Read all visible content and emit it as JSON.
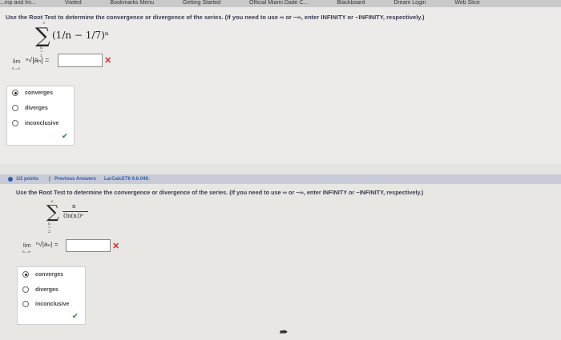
{
  "bookmarks": {
    "items": [
      "...mp and Im...",
      "Visited",
      "Bookmarks Menu",
      "Getting Started",
      "Official Miami Dade C...",
      "Blackboard",
      "Dream Login",
      "Web Slice"
    ]
  },
  "q1": {
    "instruction": "Use the Root Test to determine the convergence or divergence of the series. (If you need to use ∞ or −∞, enter INFINITY or −INFINITY, respectively.)",
    "series_top": "∞",
    "series_bottom": "n = 1",
    "series_term": "(1/n − 1/7)ⁿ",
    "lim_label": "lim",
    "lim_sub": "n→∞",
    "root_expr": "ⁿ√|aₙ| =",
    "answer_value": "",
    "result_icon": "✕",
    "options": [
      "converges",
      "diverges",
      "inconclusive"
    ],
    "selected": "converges",
    "check_icon": "✔"
  },
  "q2": {
    "points": "1/2 points",
    "separator": "|",
    "previous": "Previous Answers",
    "code": "LarCalcET6 9.6.049.",
    "instruction": "Use the Root Test to determine the convergence or divergence of the series. (If you need to use ∞ or −∞, enter INFINITY or −INFINITY, respectively.)",
    "series_top": "∞",
    "series_bottom": "n = 2",
    "series_num": "n",
    "series_den": "(ln(n))ⁿ",
    "lim_label": "lim",
    "lim_sub": "n→∞",
    "root_expr": "ⁿ√|aₙ| =",
    "answer_value": "",
    "result_icon": "✕",
    "options": [
      "converges",
      "diverges",
      "inconclusive"
    ],
    "selected": "converges",
    "check_icon": "✔"
  },
  "colors": {
    "error": "#d0312d",
    "correct": "#3a9a3a",
    "link": "#2d5fa8"
  }
}
